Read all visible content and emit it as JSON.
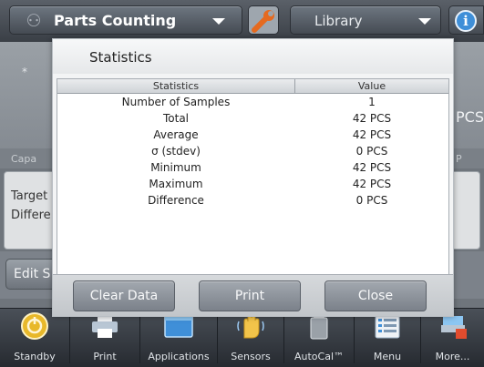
{
  "topbar": {
    "mode_label": "Parts Counting",
    "library_label": "Library",
    "info_label": "i"
  },
  "background": {
    "star": "*",
    "unit": "PCS",
    "capacity_caption": "Capa",
    "right_caption": "P",
    "target_label": "Target",
    "difference_label": "Differe",
    "edit_button_label": "Edit S"
  },
  "dialog": {
    "title": "Statistics",
    "columns": [
      "Statistics",
      "Value"
    ],
    "rows": [
      {
        "stat": "Number of Samples",
        "value": "1"
      },
      {
        "stat": "Total",
        "value": "42 PCS"
      },
      {
        "stat": "Average",
        "value": "42 PCS"
      },
      {
        "stat": "σ (stdev)",
        "value": "0 PCS"
      },
      {
        "stat": "Minimum",
        "value": "42 PCS"
      },
      {
        "stat": "Maximum",
        "value": "42 PCS"
      },
      {
        "stat": "Difference",
        "value": "0 PCS"
      }
    ],
    "buttons": {
      "clear": "Clear Data",
      "print": "Print",
      "close": "Close"
    }
  },
  "toolbar": {
    "items": [
      {
        "label": "Standby",
        "icon": "standby-icon"
      },
      {
        "label": "Print",
        "icon": "printer-icon"
      },
      {
        "label": "Applications",
        "icon": "applications-icon"
      },
      {
        "label": "Sensors",
        "icon": "sensors-hand-icon"
      },
      {
        "label": "AutoCal™",
        "icon": "autocal-weight-icon"
      },
      {
        "label": "Menu",
        "icon": "menu-list-icon"
      },
      {
        "label": "More...",
        "icon": "more-icon"
      }
    ]
  },
  "colors": {
    "accent_blue": "#3f8fd8",
    "standby_yellow": "#e8b82a"
  }
}
